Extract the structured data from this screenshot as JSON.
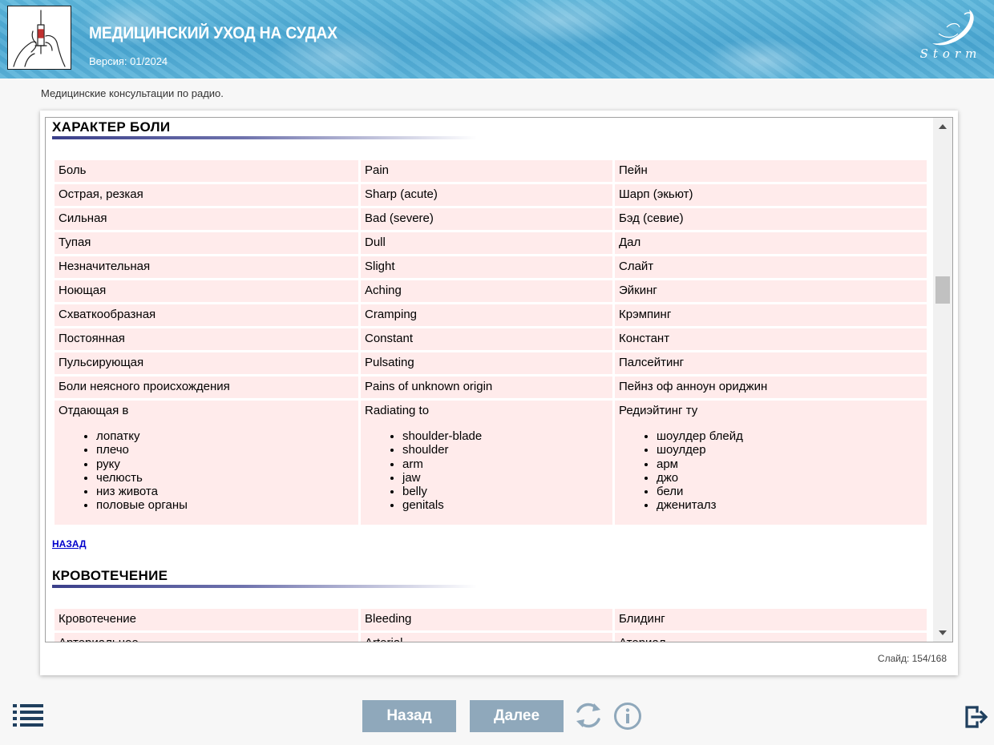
{
  "header": {
    "title": "МЕДИЦИНСКИЙ УХОД НА СУДАХ",
    "version": "Версия: 01/2024",
    "logo_icon": "syringe-hands-icon",
    "brand_text": "Storm",
    "brand_icon": "storm-wave-icon"
  },
  "subtitle": "Медицинские консультации по радио.",
  "sections": [
    {
      "title": "ХАРАКТЕР БОЛИ",
      "rows": [
        [
          "Боль",
          "Pain",
          "Пейн"
        ],
        [
          "Острая, резкая",
          "Sharp (acute)",
          "Шарп (экьют)"
        ],
        [
          "Сильная",
          "Bad (severe)",
          "Бэд (севие)"
        ],
        [
          "Тупая",
          "Dull",
          "Дал"
        ],
        [
          "Незначительная",
          "Slight",
          "Слайт"
        ],
        [
          "Ноющая",
          "Aching",
          "Эйкинг"
        ],
        [
          "Схваткообразная",
          "Cramping",
          "Крэмпинг"
        ],
        [
          "Постоянная",
          "Constant",
          "Констант"
        ],
        [
          "Пульсирующая",
          "Pulsating",
          "Палсейтинг"
        ],
        [
          "Боли неясного происхождения",
          "Pains of unknown origin",
          "Пейнз оф анноун ориджин"
        ]
      ],
      "list_row": {
        "heads": [
          "Отдающая в",
          "Radiating to",
          "Редиэйтинг ту"
        ],
        "items": [
          [
            "лопатку",
            "плечо",
            "руку",
            "челюсть",
            "низ живота",
            "половые органы"
          ],
          [
            "shoulder-blade",
            "shoulder",
            "arm",
            "jaw",
            "belly",
            "genitals"
          ],
          [
            "шоулдер блейд",
            "шоулдер",
            "арм",
            "джо",
            "бели",
            "джениталз"
          ]
        ]
      },
      "back_link": "НАЗАД"
    },
    {
      "title": "КРОВОТЕЧЕНИЕ",
      "rows": [
        [
          "Кровотечение",
          "Bleeding",
          "Блидинг"
        ],
        [
          "Артериальное",
          "Arterial",
          "Атериал"
        ]
      ]
    }
  ],
  "slide_counter": "Слайд:  154/168",
  "footer": {
    "back_label": "Назад",
    "next_label": "Далее",
    "menu_icon": "menu-list-icon",
    "refresh_icon": "refresh-icon",
    "info_icon": "info-icon",
    "exit_icon": "exit-icon"
  },
  "colors": {
    "header_blue": "#4aa7d2",
    "row_bg": "#ffebeb",
    "button_bg": "#8fa8bb",
    "icon_dark": "#1f3f5e",
    "icon_light": "#8fa8bb",
    "link": "#0000cc"
  }
}
